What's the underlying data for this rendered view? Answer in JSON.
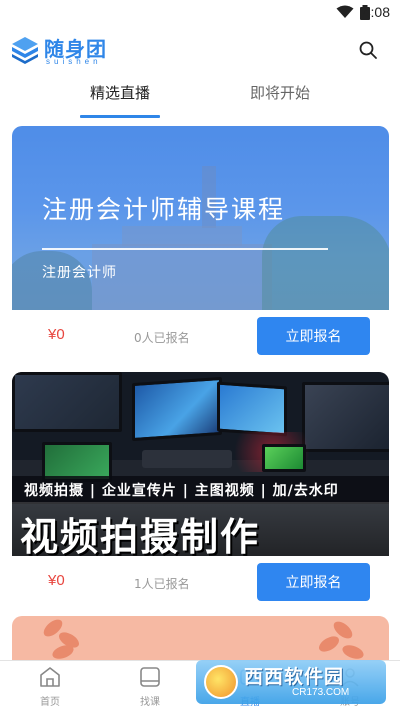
{
  "status_bar": {
    "time": "4:08"
  },
  "header": {
    "logo_name": "随身团",
    "logo_sub": "suishen",
    "search_icon": "search-icon"
  },
  "tabs": [
    {
      "label": "精选直播",
      "active": true
    },
    {
      "label": "即将开始",
      "active": false
    }
  ],
  "courses": [
    {
      "banner_title": "注册会计师辅导课程",
      "banner_subtitle": "注册会计师",
      "price": "¥0",
      "enrolled": "0人已报名",
      "button": "立即报名"
    },
    {
      "banner_tagline": "视频拍摄 | 企业宣传片 | 主图视频 | 加/去水印",
      "banner_title": "视频拍摄制作",
      "price": "¥0",
      "enrolled": "1人已报名",
      "button": "立即报名"
    },
    {
      "banner_title": ""
    }
  ],
  "bottom_nav": [
    {
      "label": "首页",
      "icon": "home-icon",
      "active": false
    },
    {
      "label": "找课",
      "icon": "course-icon",
      "active": false
    },
    {
      "label": "直播",
      "icon": "live-icon",
      "active": true
    },
    {
      "label": "账号",
      "icon": "account-icon",
      "active": false
    }
  ],
  "watermark": {
    "text": "西西软件园",
    "url": "CR173.COM"
  },
  "colors": {
    "accent": "#2f86f0",
    "price": "#e8463f"
  }
}
